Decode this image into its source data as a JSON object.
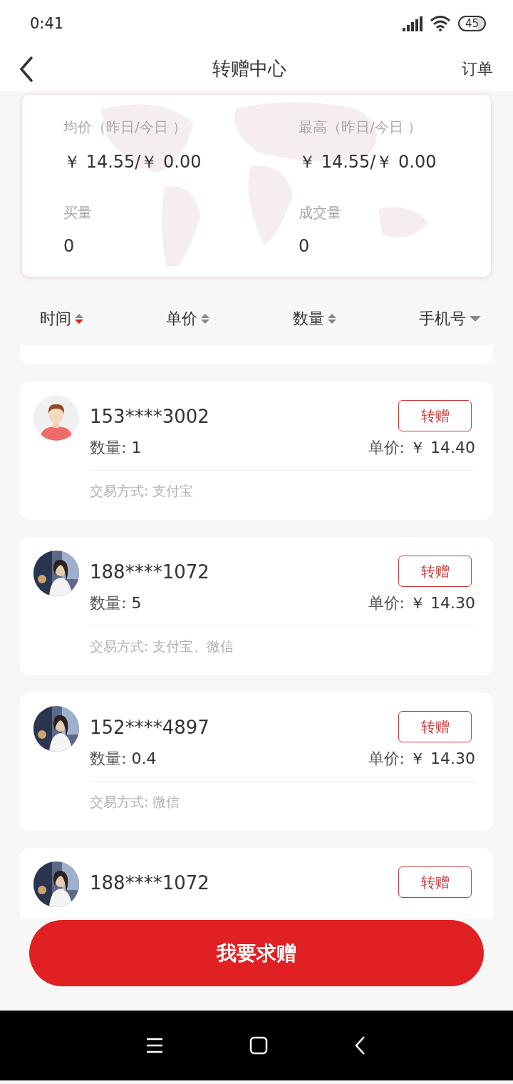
{
  "status_bar": {
    "time": "0:41",
    "battery": "45"
  },
  "header": {
    "title": "转赠中心",
    "action": "订单"
  },
  "stats": [
    {
      "label": "均价（昨日/今日 ）",
      "value": "￥ 14.55/￥ 0.00"
    },
    {
      "label": "最高（昨日/今日 ）",
      "value": "￥ 14.55/￥ 0.00"
    },
    {
      "label": "买量",
      "value": "0"
    },
    {
      "label": "成交量",
      "value": "0"
    }
  ],
  "sort_options": [
    {
      "label": "时间",
      "kind": "updown",
      "selected": true
    },
    {
      "label": "单价",
      "kind": "updown",
      "selected": false
    },
    {
      "label": "数量",
      "kind": "updown",
      "selected": false
    },
    {
      "label": "手机号",
      "kind": "down",
      "selected": false
    }
  ],
  "offers": [
    {
      "avatar": {
        "kind": "avatar"
      },
      "phone": "153****3002",
      "quantity_label": "数量:",
      "quantity": "1",
      "price_label": "单价:",
      "price": "￥ 14.40",
      "method": "交易方式: 支付宝",
      "action": "转赠"
    },
    {
      "phone": "188****1072",
      "quantity_label": "数量:",
      "quantity": "5",
      "price_label": "单价:",
      "price": "￥ 14.30",
      "method": "交易方式: 支付宝、微信",
      "action": "转赠"
    },
    {
      "phone": "152****4897",
      "quantity_label": "数量:",
      "quantity": "0.4",
      "price_label": "单价:",
      "price": "￥ 14.30",
      "method": "交易方式: 微信",
      "action": "转赠"
    },
    {
      "phone": "188****1072",
      "action": "转赠"
    }
  ],
  "primary_button": "我要求赠"
}
